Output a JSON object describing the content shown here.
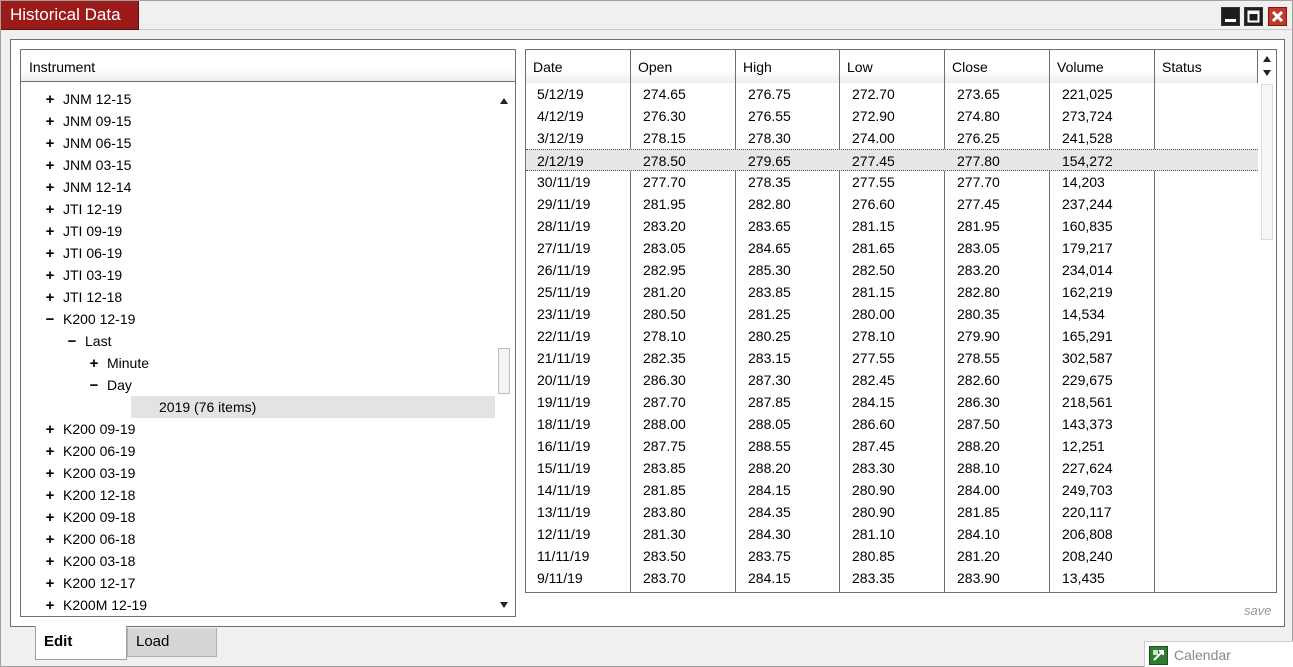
{
  "window": {
    "title": "Historical Data",
    "save_label": "save",
    "colors": {
      "title_bg": "#9b1b1b",
      "close_btn": "#c0392b"
    }
  },
  "tree": {
    "header": "Instrument",
    "nodes": [
      {
        "label": "JNM 12-15",
        "toggle": "+",
        "level": 0
      },
      {
        "label": "JNM 09-15",
        "toggle": "+",
        "level": 0
      },
      {
        "label": "JNM 06-15",
        "toggle": "+",
        "level": 0
      },
      {
        "label": "JNM 03-15",
        "toggle": "+",
        "level": 0
      },
      {
        "label": "JNM 12-14",
        "toggle": "+",
        "level": 0
      },
      {
        "label": "JTI 12-19",
        "toggle": "+",
        "level": 0
      },
      {
        "label": "JTI 09-19",
        "toggle": "+",
        "level": 0
      },
      {
        "label": "JTI 06-19",
        "toggle": "+",
        "level": 0
      },
      {
        "label": "JTI 03-19",
        "toggle": "+",
        "level": 0
      },
      {
        "label": "JTI 12-18",
        "toggle": "+",
        "level": 0
      },
      {
        "label": "K200 12-19",
        "toggle": "−",
        "level": 0
      },
      {
        "label": "Last",
        "toggle": "−",
        "level": 1
      },
      {
        "label": "Minute",
        "toggle": "+",
        "level": 2
      },
      {
        "label": "Day",
        "toggle": "−",
        "level": 2
      },
      {
        "label": "2019 (76 items)",
        "toggle": "",
        "level": 3,
        "selected": true
      },
      {
        "label": "K200 09-19",
        "toggle": "+",
        "level": 0
      },
      {
        "label": "K200 06-19",
        "toggle": "+",
        "level": 0
      },
      {
        "label": "K200 03-19",
        "toggle": "+",
        "level": 0
      },
      {
        "label": "K200 12-18",
        "toggle": "+",
        "level": 0
      },
      {
        "label": "K200 09-18",
        "toggle": "+",
        "level": 0
      },
      {
        "label": "K200 06-18",
        "toggle": "+",
        "level": 0
      },
      {
        "label": "K200 03-18",
        "toggle": "+",
        "level": 0
      },
      {
        "label": "K200 12-17",
        "toggle": "+",
        "level": 0
      },
      {
        "label": "K200M 12-19",
        "toggle": "+",
        "level": 0
      }
    ]
  },
  "grid": {
    "columns": [
      "Date",
      "Open",
      "High",
      "Low",
      "Close",
      "Volume",
      "Status"
    ],
    "selected_row": 3,
    "rows": [
      [
        "5/12/19",
        "274.65",
        "276.75",
        "272.70",
        "273.65",
        "221,025",
        ""
      ],
      [
        "4/12/19",
        "276.30",
        "276.55",
        "272.90",
        "274.80",
        "273,724",
        ""
      ],
      [
        "3/12/19",
        "278.15",
        "278.30",
        "274.00",
        "276.25",
        "241,528",
        ""
      ],
      [
        "2/12/19",
        "278.50",
        "279.65",
        "277.45",
        "277.80",
        "154,272",
        ""
      ],
      [
        "30/11/19",
        "277.70",
        "278.35",
        "277.55",
        "277.70",
        "14,203",
        ""
      ],
      [
        "29/11/19",
        "281.95",
        "282.80",
        "276.60",
        "277.45",
        "237,244",
        ""
      ],
      [
        "28/11/19",
        "283.20",
        "283.65",
        "281.15",
        "281.95",
        "160,835",
        ""
      ],
      [
        "27/11/19",
        "283.05",
        "284.65",
        "281.65",
        "283.05",
        "179,217",
        ""
      ],
      [
        "26/11/19",
        "282.95",
        "285.30",
        "282.50",
        "283.20",
        "234,014",
        ""
      ],
      [
        "25/11/19",
        "281.20",
        "283.85",
        "281.15",
        "282.80",
        "162,219",
        ""
      ],
      [
        "23/11/19",
        "280.50",
        "281.25",
        "280.00",
        "280.35",
        "14,534",
        ""
      ],
      [
        "22/11/19",
        "278.10",
        "280.25",
        "278.10",
        "279.90",
        "165,291",
        ""
      ],
      [
        "21/11/19",
        "282.35",
        "283.15",
        "277.55",
        "278.55",
        "302,587",
        ""
      ],
      [
        "20/11/19",
        "286.30",
        "287.30",
        "282.45",
        "282.60",
        "229,675",
        ""
      ],
      [
        "19/11/19",
        "287.70",
        "287.85",
        "284.15",
        "286.30",
        "218,561",
        ""
      ],
      [
        "18/11/19",
        "288.00",
        "288.05",
        "286.60",
        "287.50",
        "143,373",
        ""
      ],
      [
        "16/11/19",
        "287.75",
        "288.55",
        "287.45",
        "288.20",
        "12,251",
        ""
      ],
      [
        "15/11/19",
        "283.85",
        "288.20",
        "283.30",
        "288.10",
        "227,624",
        ""
      ],
      [
        "14/11/19",
        "281.85",
        "284.15",
        "280.90",
        "284.00",
        "249,703",
        ""
      ],
      [
        "13/11/19",
        "283.80",
        "284.35",
        "280.90",
        "281.85",
        "220,117",
        ""
      ],
      [
        "12/11/19",
        "281.30",
        "284.30",
        "281.10",
        "284.10",
        "206,808",
        ""
      ],
      [
        "11/11/19",
        "283.50",
        "283.75",
        "280.85",
        "281.20",
        "208,240",
        ""
      ],
      [
        "9/11/19",
        "283.70",
        "284.15",
        "283.35",
        "283.90",
        "13,435",
        ""
      ]
    ]
  },
  "tabs": {
    "edit": "Edit",
    "load": "Load"
  },
  "taskbar": {
    "label": "Calendar"
  }
}
